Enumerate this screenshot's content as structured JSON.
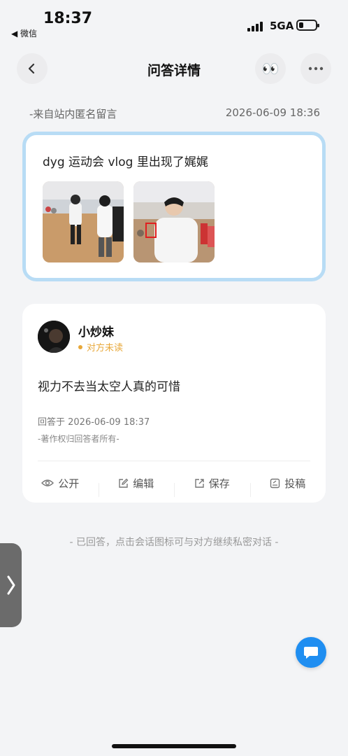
{
  "status": {
    "time": "18:37",
    "back_app": "◀ 微信",
    "network": "5GA"
  },
  "nav": {
    "title": "问答详情",
    "back_icon": "chevron-left-icon",
    "eyes_emoji": "👀",
    "more_icon": "more-dots-icon"
  },
  "question": {
    "source": "-来自站内匿名留言",
    "time": "2026-06-09 18:36",
    "text": "dyg 运动会 vlog 里出现了娓娓"
  },
  "answer": {
    "name": "小炒妹",
    "status": "对方未读",
    "text": "视力不去当太空人真的可惜",
    "time": "回答于 2026-06-09 18:37",
    "copyright": "-著作权归回答者所有-",
    "actions": [
      {
        "label": "公开",
        "icon": "eye-icon"
      },
      {
        "label": "编辑",
        "icon": "edit-icon"
      },
      {
        "label": "保存",
        "icon": "share-icon"
      },
      {
        "label": "投稿",
        "icon": "submit-icon"
      }
    ]
  },
  "footer_hint": "- 已回答，点击会话图标可与对方继续私密对话 -",
  "colors": {
    "accent_blue": "#1f8ef1",
    "card_border": "#b8dcf5",
    "unread": "#e8a83a"
  }
}
